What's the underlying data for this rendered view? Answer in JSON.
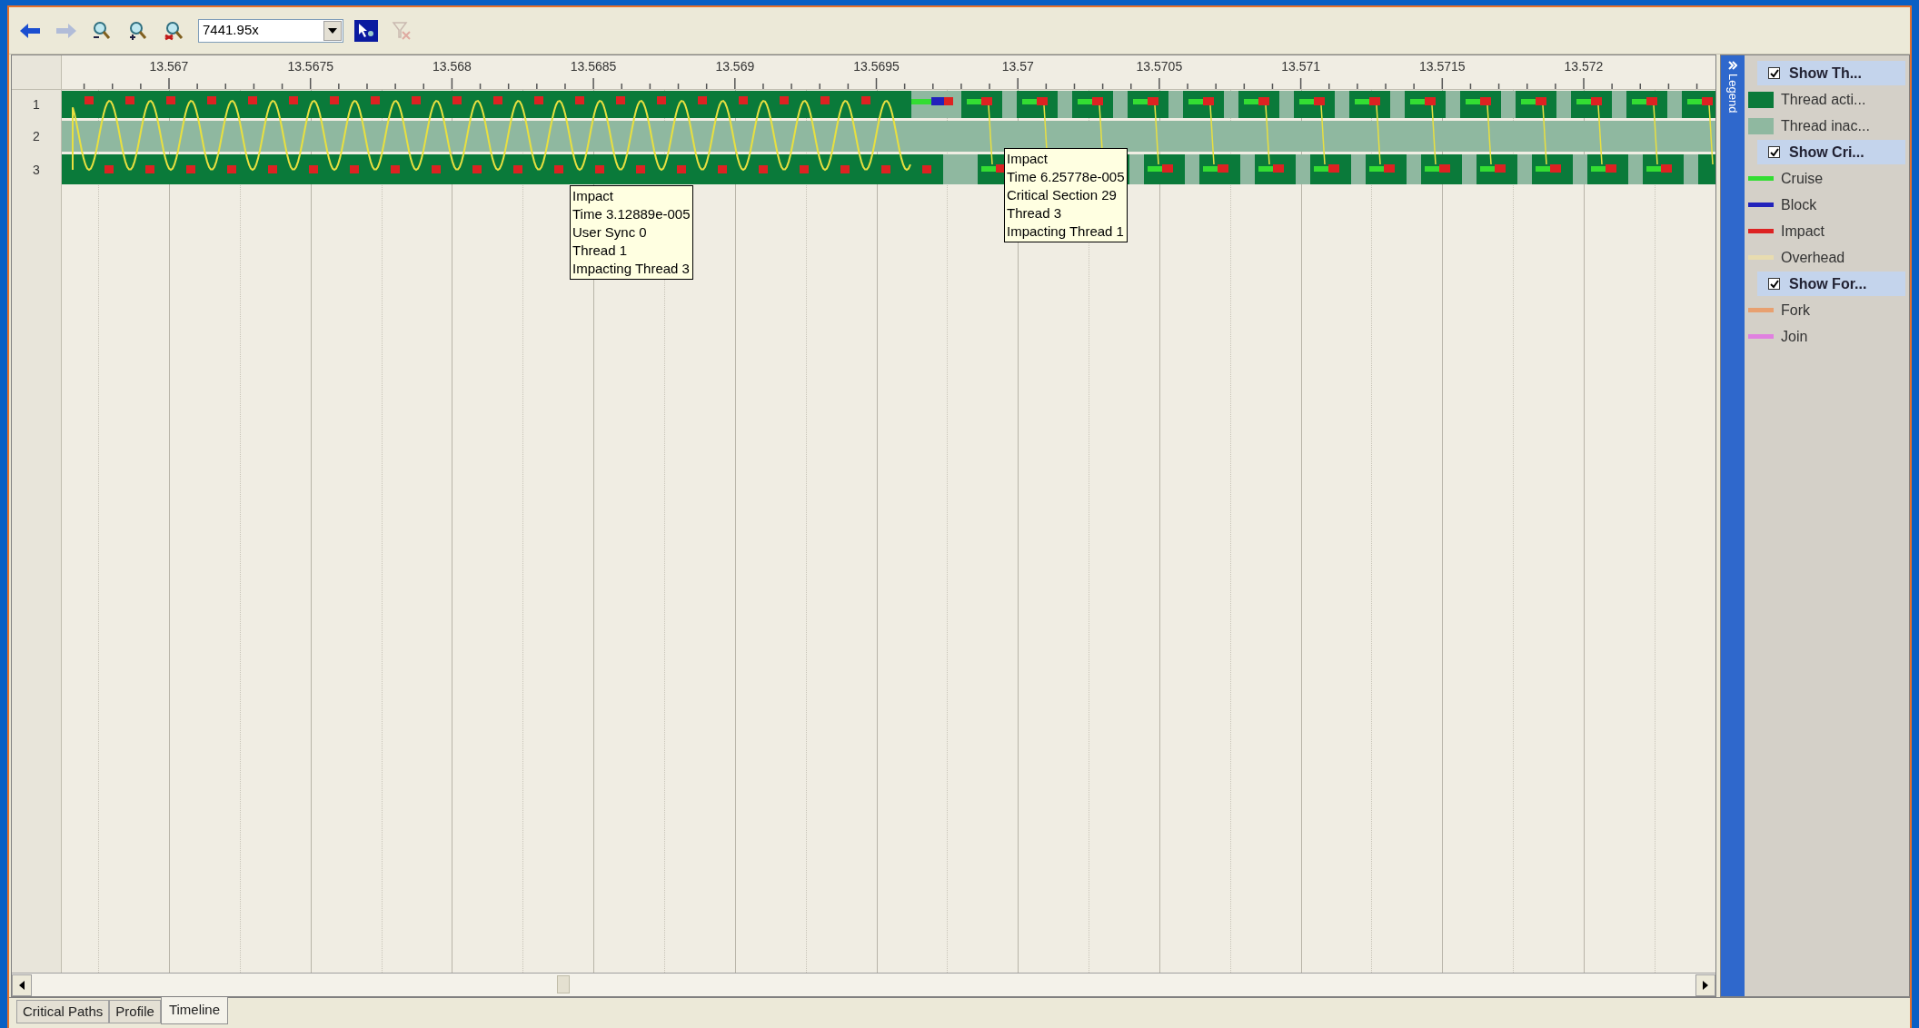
{
  "toolbar": {
    "left_buttons": [
      {
        "kind": "back",
        "disabled": false
      },
      {
        "kind": "forward",
        "disabled": true
      },
      {
        "kind": "zoom-in",
        "disabled": false
      },
      {
        "kind": "zoom-out",
        "disabled": false
      },
      {
        "kind": "zoom-reset",
        "disabled": false
      }
    ],
    "zoom_combo": {
      "value": "7441.95x"
    },
    "right_buttons": [
      {
        "kind": "select-mode",
        "disabled": false
      },
      {
        "kind": "clear-filter",
        "disabled": true
      }
    ]
  },
  "timeline": {
    "ruler_ticks": [
      "13.567",
      "13.5675",
      "13.568",
      "13.5685",
      "13.569",
      "13.5695",
      "13.57",
      "13.5705",
      "13.571",
      "13.5715",
      "13.572"
    ],
    "threads": [
      {
        "label": "1"
      },
      {
        "label": "2"
      },
      {
        "label": "3"
      }
    ],
    "tooltips": [
      {
        "lines": [
          "Impact",
          "Time 3.12889e-005",
          "User Sync 0",
          "Thread 1",
          "Impacting Thread 3"
        ]
      },
      {
        "lines": [
          "Impact",
          "Time 6.25778e-005",
          "Critical Section 29",
          "Thread 3",
          "Impacting Thread 1"
        ]
      }
    ]
  },
  "legend": {
    "title": "Legend",
    "items": [
      {
        "kind": "header",
        "label": "Show Th...",
        "checked": true
      },
      {
        "kind": "swatch",
        "label": "Thread acti...",
        "color": "#0a7a3a"
      },
      {
        "kind": "swatch",
        "label": "Thread inac...",
        "color": "#8fb8a0"
      },
      {
        "kind": "header",
        "label": "Show Cri...",
        "checked": true
      },
      {
        "kind": "line",
        "label": "Cruise",
        "color": "#33dd33"
      },
      {
        "kind": "line",
        "label": "Block",
        "color": "#2222bb"
      },
      {
        "kind": "line",
        "label": "Impact",
        "color": "#dd2222"
      },
      {
        "kind": "line",
        "label": "Overhead",
        "color": "#e8dcb0"
      },
      {
        "kind": "header",
        "label": "Show For...",
        "checked": true
      },
      {
        "kind": "line",
        "label": "Fork",
        "color": "#e8a070"
      },
      {
        "kind": "line",
        "label": "Join",
        "color": "#e080e0"
      }
    ]
  },
  "tabs": [
    {
      "label": "Critical Paths",
      "selected": false
    },
    {
      "label": "Profile",
      "selected": false
    },
    {
      "label": "Timeline",
      "selected": true
    }
  ]
}
